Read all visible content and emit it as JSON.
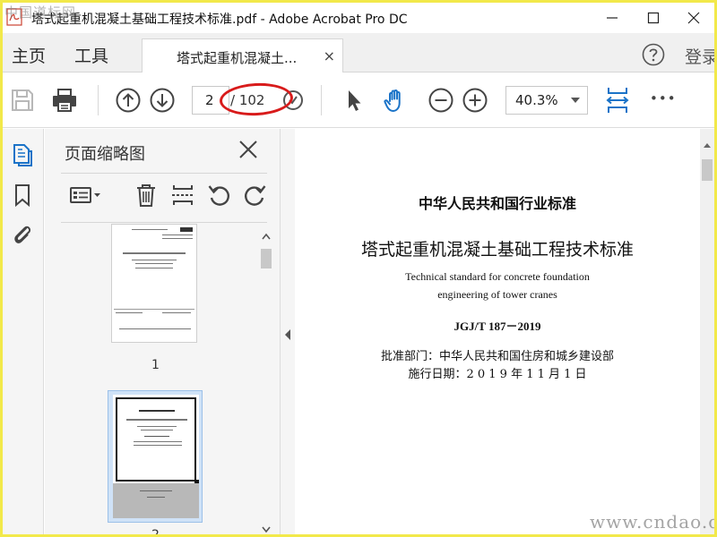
{
  "window": {
    "title": "塔式起重机混凝土基础工程技术标准.pdf - Adobe Acrobat Pro DC",
    "watermark_top": "中国道标网",
    "watermark_bottom": "www.cndao.com"
  },
  "tabs": {
    "home": "主页",
    "tools": "工具",
    "document_tab": "塔式起重机混凝土...",
    "close_glyph": "×",
    "login": "登录"
  },
  "toolbar": {
    "current_page": "2",
    "total_pages": "/ 102",
    "zoom": "40.3%",
    "more_glyph": "•••"
  },
  "panel": {
    "title": "页面缩略图",
    "thumbnails": [
      {
        "number": "1"
      },
      {
        "number": "2"
      }
    ]
  },
  "document": {
    "header": "中华人民共和国行业标准",
    "title_cn": "塔式起重机混凝土基础工程技术标准",
    "title_en_line1": "Technical standard for concrete foundation",
    "title_en_line2": "engineering of tower cranes",
    "code": "JGJ/T 187－2019",
    "approver": "批准部门：中华人民共和国住房和城乡建设部",
    "effective_date": "施行日期：2 0 1 9 年 1 1 月 1 日"
  },
  "colors": {
    "accent": "#1a73c8",
    "annotation_oval": "#d81b1b",
    "screen_border": "#f2e94a"
  }
}
